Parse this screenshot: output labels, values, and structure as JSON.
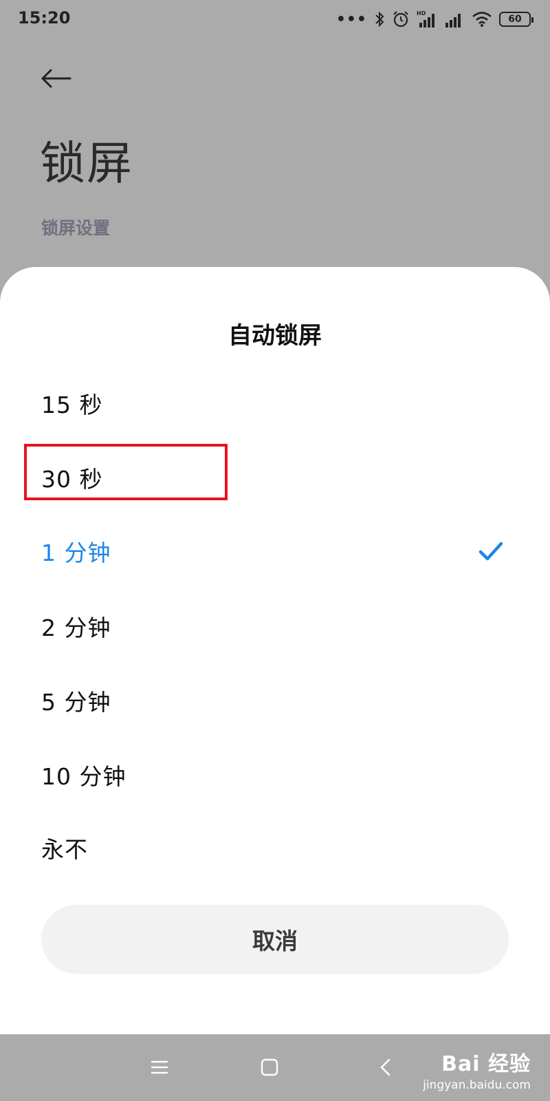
{
  "status_bar": {
    "time": "15:20",
    "dots": "•••",
    "battery": "60",
    "icons": [
      "bluetooth-icon",
      "alarm-icon",
      "hd-signal-icon",
      "signal-icon",
      "wifi-icon",
      "battery-icon"
    ]
  },
  "page": {
    "title": "锁屏",
    "section_label": "锁屏设置"
  },
  "dialog": {
    "title": "自动锁屏",
    "options": [
      {
        "label": "15 秒",
        "selected": false
      },
      {
        "label": "30 秒",
        "selected": false
      },
      {
        "label": "1 分钟",
        "selected": true
      },
      {
        "label": "2 分钟",
        "selected": false
      },
      {
        "label": "5 分钟",
        "selected": false
      },
      {
        "label": "10 分钟",
        "selected": false
      },
      {
        "label": "永不",
        "selected": false
      }
    ],
    "cancel_label": "取消"
  },
  "watermark": {
    "brand": "Bai 经验",
    "url": "jingyan.baidu.com"
  },
  "colors": {
    "accent": "#1a86e8",
    "highlight": "#e5131d",
    "scrim": "#ababab"
  }
}
